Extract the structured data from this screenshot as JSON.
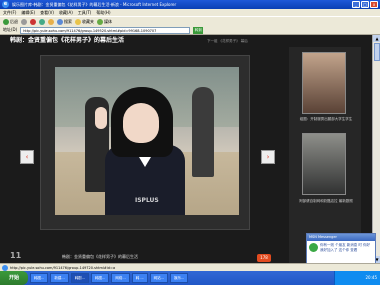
{
  "window": {
    "title": "娱乐图片库-韩剧：金贤重偏包《花样男子》的幕后生活-新浪 - Microsoft Internet Explorer",
    "buttons": [
      "_",
      "□",
      "x"
    ]
  },
  "menu": [
    "文件(F)",
    "编辑(E)",
    "查看(V)",
    "收藏(A)",
    "工具(T)",
    "帮助(H)"
  ],
  "toolbar": {
    "back": "后退",
    "forward": "",
    "search": "搜索",
    "favorites": "收藏夹",
    "media": "媒体"
  },
  "address": {
    "label": "地址(D)",
    "value": "http://pic.yule.sohu.com/911476/group-149520.shtml#pid=99168-1090707",
    "go": "转到",
    "links": [
      "链接"
    ]
  },
  "page": {
    "title": "韩剧：金贤重偏包《花样男子》的幕后生活",
    "top_links": "下一组  《花样男子》 幕后 ",
    "watermark": "ISPLUS",
    "caption": "韩剧：金贤重偏包《花样男子》的幕后生活",
    "page_number": "11",
    "counter": "178",
    "arrow_left": "‹",
    "arrow_right": "›"
  },
  "side": {
    "thumb1_caption": "组图：开制服秀出腿部大学生学生",
    "thumb2_caption": "阿部健自制网和奶酪店拉 最新剧照"
  },
  "msn": {
    "title": "MSN Messenger",
    "text": "你有一则 个朋友 新消息 时 你好我好加入了 这个你 查看"
  },
  "status": {
    "text": "http://pic.yule.sohu.com/911476/group-149720.shtml#id=a"
  },
  "taskbar": {
    "start": "开始",
    "tasks": [
      "韩图...",
      "新建...",
      "韩剧...",
      "韩图...",
      "网络...",
      "韩 ...",
      "网站...",
      "娱乐..."
    ],
    "clock": "20:45"
  }
}
